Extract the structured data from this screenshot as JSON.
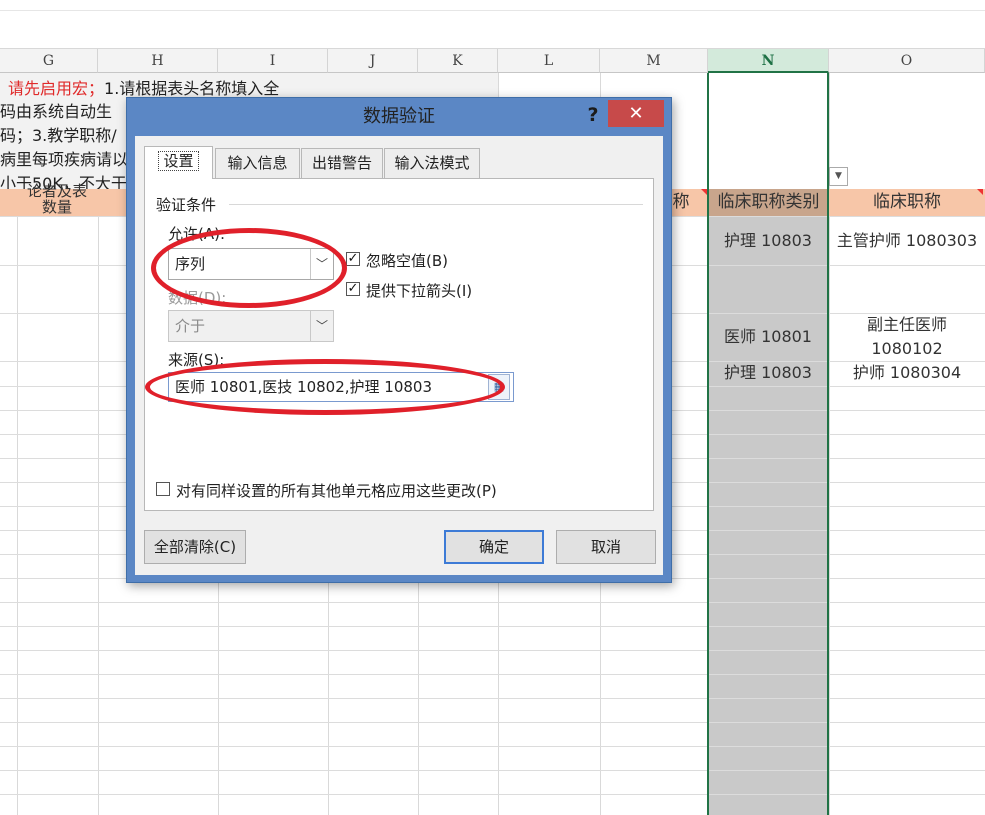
{
  "columns": [
    "G",
    "H",
    "I",
    "J",
    "K",
    "L",
    "M",
    "N",
    "O"
  ],
  "selected_column": "N",
  "instructions": [
    {
      "red": "请先启用宏；",
      "text": "1.请根据表头名称填入全"
    },
    {
      "text": "码由系统自动生"
    },
    {
      "text": "码；3.教学职称/"
    },
    {
      "text": "病里每项疾病请以"
    },
    {
      "text": "小于50K，不大于"
    }
  ],
  "header_row": {
    "left_fragment": "论者及表",
    "left_fragment2": "数量",
    "partial": "称",
    "col_n": "临床职称类别",
    "col_o": "临床职称"
  },
  "cells": {
    "n1": "护理  10803",
    "o1": "主管护师  1080303",
    "n2": "医师  10801",
    "o2a": "副主任医师",
    "o2b": "1080102",
    "n3": "护理  10803",
    "o3": "护师  1080304"
  },
  "filter_icon": "dropdown-arrow-icon",
  "dialog": {
    "title": "数据验证",
    "help": "?",
    "close": "✕",
    "tabs": [
      "设置",
      "输入信息",
      "出错警告",
      "输入法模式"
    ],
    "active_tab": 0,
    "section": "验证条件",
    "allow_label": "允许(A):",
    "allow_value": "序列",
    "ignore_blank": "忽略空值(B)",
    "ignore_blank_checked": true,
    "dropdown": "提供下拉箭头(I)",
    "dropdown_checked": true,
    "data_label": "数据(D):",
    "data_value": "介于",
    "source_label": "来源(S):",
    "source_value": "医师 10801,医技 10802,护理 10803",
    "apply_all": "对有同样设置的所有其他单元格应用这些更改(P)",
    "apply_all_checked": false,
    "clear_btn": "全部清除(C)",
    "ok_btn": "确定",
    "cancel_btn": "取消"
  },
  "annotation_color": "#e0202a",
  "accent_color": "#217346"
}
